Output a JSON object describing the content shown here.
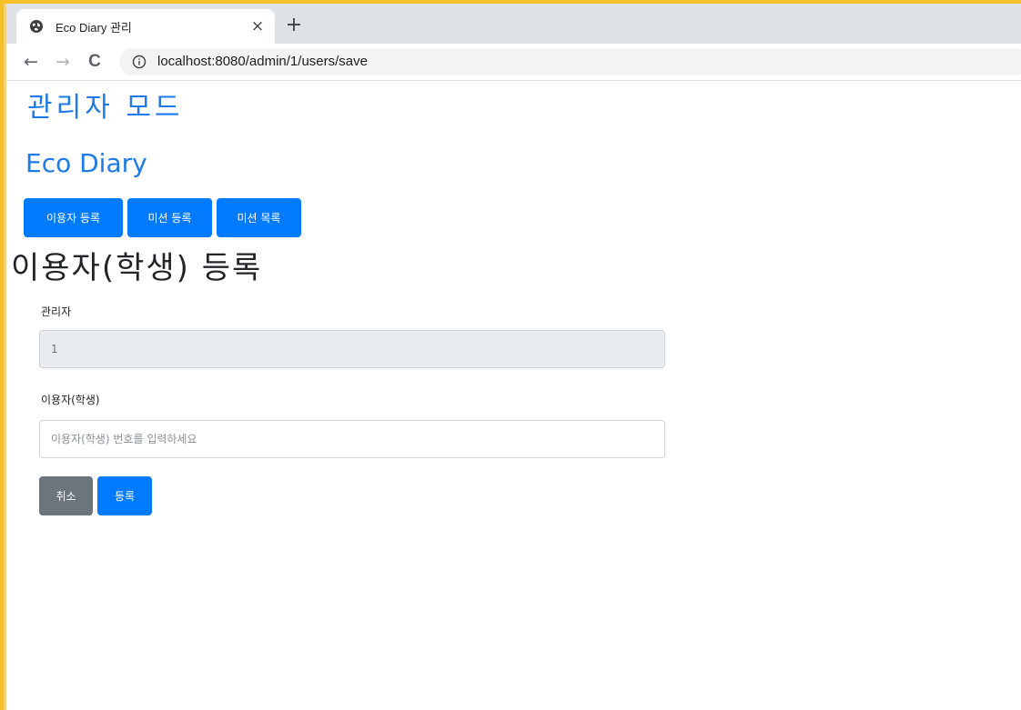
{
  "browser": {
    "tab_title": "Eco Diary 관리",
    "tab_close": "×",
    "new_tab": "+",
    "url": "localhost:8080/admin/1/users/save",
    "back": "←",
    "forward": "→",
    "reload": "C"
  },
  "page": {
    "admin_title": "관리자 모드",
    "brand": "Eco Diary",
    "nav_buttons": [
      "이용자 등록",
      "미션 등록",
      "미션 목록"
    ],
    "section_title": "이용자(학생) 등록",
    "form": {
      "admin_label": "관리자",
      "admin_value": "1",
      "user_label": "이용자(학생)",
      "user_placeholder": "이용자(학생) 번호를 입력하세요",
      "user_value": "",
      "cancel_label": "취소",
      "submit_label": "등록"
    }
  },
  "colors": {
    "primary": "#007bff",
    "secondary": "#6c757d",
    "heading_blue": "#1e7ae6",
    "window_border": "#f5c026"
  }
}
